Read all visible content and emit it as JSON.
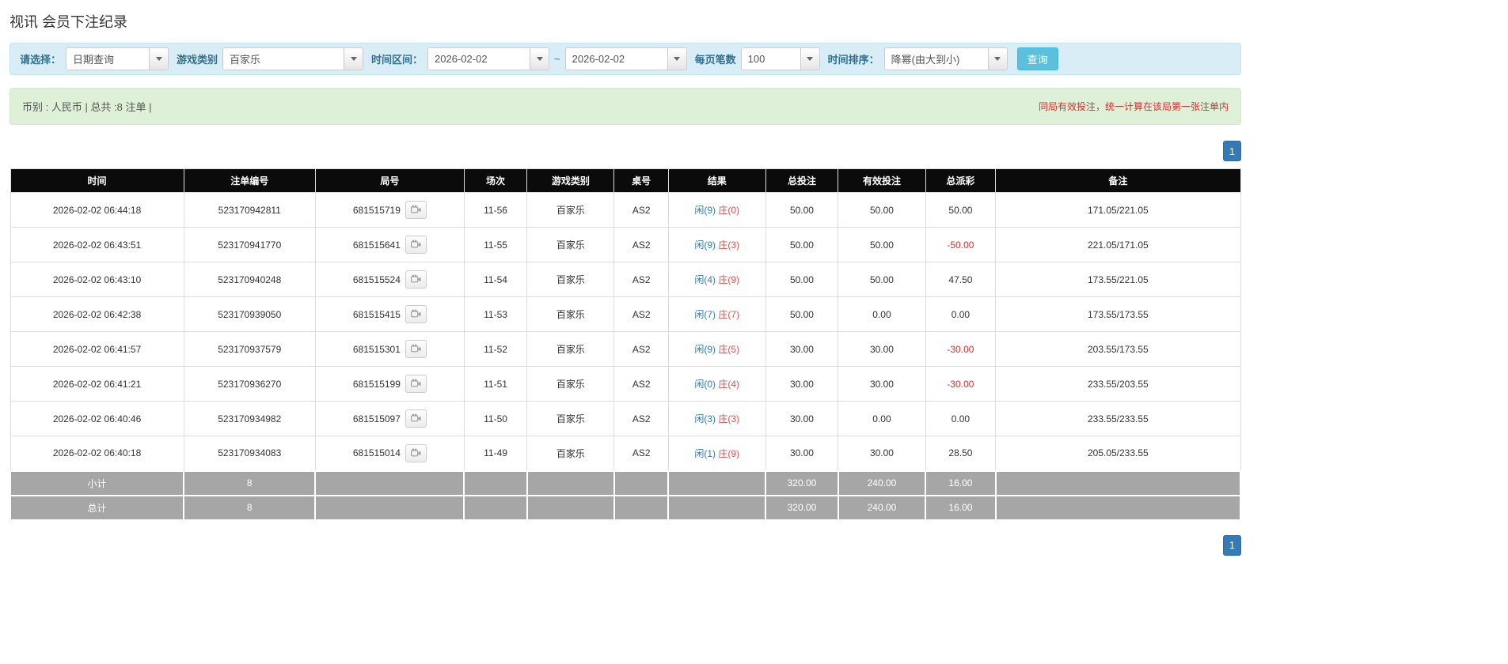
{
  "page": {
    "title": "视讯 会员下注纪录"
  },
  "filters": {
    "select_label": "请选择：",
    "select_value": "日期查询",
    "game_type_label": "游戏类别",
    "game_type_value": "百家乐",
    "time_range_label": "时间区间：",
    "date_from": "2026-02-02",
    "range_separator": "~",
    "date_to": "2026-02-02",
    "per_page_label": "每页笔数",
    "per_page_value": "100",
    "sort_label": "时间排序：",
    "sort_value": "降幂(由大到小)",
    "query_button_label": "查询"
  },
  "summary_bar": {
    "currency_info": "币别 : 人民币 | 总共 :8 注单 |",
    "notice": "同局有效投注，统一计算在该局第一张注单内"
  },
  "pagination": {
    "current_page": "1"
  },
  "icons": {
    "combo_caret": "caret-down-icon",
    "round_replay": "video-camera-icon"
  },
  "colors": {
    "link_blue": "#337ab7",
    "banker_red": "#d9534f",
    "negative_red": "#e02b2b",
    "query_button_teal": "#5bc0de",
    "filter_bar_bg": "#d9edf7",
    "summary_bar_bg": "#dff0d8",
    "table_header_bg": "#0b0b0b",
    "summary_row_bg": "#a6a6a6"
  },
  "table": {
    "headers": [
      "时间",
      "注单编号",
      "局号",
      "场次",
      "游戏类别",
      "桌号",
      "结果",
      "总投注",
      "有效投注",
      "总派彩",
      "备注"
    ],
    "rows": [
      {
        "time": "2026-02-02 06:44:18",
        "bet_id": "523170942811",
        "round_id": "681515719",
        "session": "11-56",
        "game_type": "百家乐",
        "table_no": "AS2",
        "result_player": "闲(9)",
        "result_banker": "庄(0)",
        "total_bet": "50.00",
        "valid_bet": "50.00",
        "payout": "50.00",
        "note": "171.05/221.05"
      },
      {
        "time": "2026-02-02 06:43:51",
        "bet_id": "523170941770",
        "round_id": "681515641",
        "session": "11-55",
        "game_type": "百家乐",
        "table_no": "AS2",
        "result_player": "闲(9)",
        "result_banker": "庄(3)",
        "total_bet": "50.00",
        "valid_bet": "50.00",
        "payout": "-50.00",
        "note": "221.05/171.05"
      },
      {
        "time": "2026-02-02 06:43:10",
        "bet_id": "523170940248",
        "round_id": "681515524",
        "session": "11-54",
        "game_type": "百家乐",
        "table_no": "AS2",
        "result_player": "闲(4)",
        "result_banker": "庄(9)",
        "total_bet": "50.00",
        "valid_bet": "50.00",
        "payout": "47.50",
        "note": "173.55/221.05"
      },
      {
        "time": "2026-02-02 06:42:38",
        "bet_id": "523170939050",
        "round_id": "681515415",
        "session": "11-53",
        "game_type": "百家乐",
        "table_no": "AS2",
        "result_player": "闲(7)",
        "result_banker": "庄(7)",
        "total_bet": "50.00",
        "valid_bet": "0.00",
        "payout": "0.00",
        "note": "173.55/173.55"
      },
      {
        "time": "2026-02-02 06:41:57",
        "bet_id": "523170937579",
        "round_id": "681515301",
        "session": "11-52",
        "game_type": "百家乐",
        "table_no": "AS2",
        "result_player": "闲(9)",
        "result_banker": "庄(5)",
        "total_bet": "30.00",
        "valid_bet": "30.00",
        "payout": "-30.00",
        "note": "203.55/173.55"
      },
      {
        "time": "2026-02-02 06:41:21",
        "bet_id": "523170936270",
        "round_id": "681515199",
        "session": "11-51",
        "game_type": "百家乐",
        "table_no": "AS2",
        "result_player": "闲(0)",
        "result_banker": "庄(4)",
        "total_bet": "30.00",
        "valid_bet": "30.00",
        "payout": "-30.00",
        "note": "233.55/203.55"
      },
      {
        "time": "2026-02-02 06:40:46",
        "bet_id": "523170934982",
        "round_id": "681515097",
        "session": "11-50",
        "game_type": "百家乐",
        "table_no": "AS2",
        "result_player": "闲(3)",
        "result_banker": "庄(3)",
        "total_bet": "30.00",
        "valid_bet": "0.00",
        "payout": "0.00",
        "note": "233.55/233.55"
      },
      {
        "time": "2026-02-02 06:40:18",
        "bet_id": "523170934083",
        "round_id": "681515014",
        "session": "11-49",
        "game_type": "百家乐",
        "table_no": "AS2",
        "result_player": "闲(1)",
        "result_banker": "庄(9)",
        "total_bet": "30.00",
        "valid_bet": "30.00",
        "payout": "28.50",
        "note": "205.05/233.55"
      }
    ],
    "subtotal": {
      "label": "小计",
      "count": "8",
      "total_bet": "320.00",
      "valid_bet": "240.00",
      "payout": "16.00"
    },
    "total": {
      "label": "总计",
      "count": "8",
      "total_bet": "320.00",
      "valid_bet": "240.00",
      "payout": "16.00"
    }
  }
}
